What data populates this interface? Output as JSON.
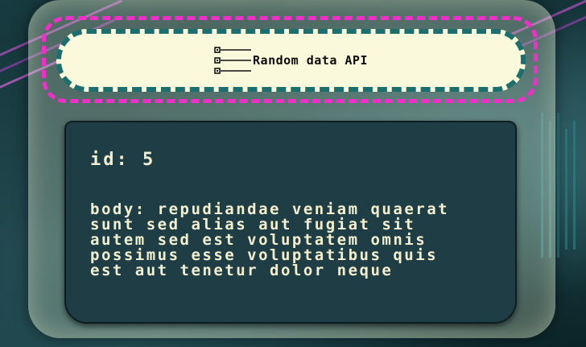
{
  "header": {
    "title": "Random data API",
    "icon": "tree-list-icon"
  },
  "record": {
    "id_label": "id:",
    "id_value": "5",
    "body_label": "body:",
    "body_value": "repudiandae veniam quaerat sunt sed alias aut fugiat sit autem sed est voluptatem omnis possimus esse voluptatibus quis est aut tenetur dolor neque"
  },
  "colors": {
    "accent_pink": "#f02ec8",
    "accent_teal": "#1b6f6f",
    "pill_background": "#fbf9dc",
    "card_background": "#1f3d44",
    "card_text": "#f3f0cf"
  }
}
